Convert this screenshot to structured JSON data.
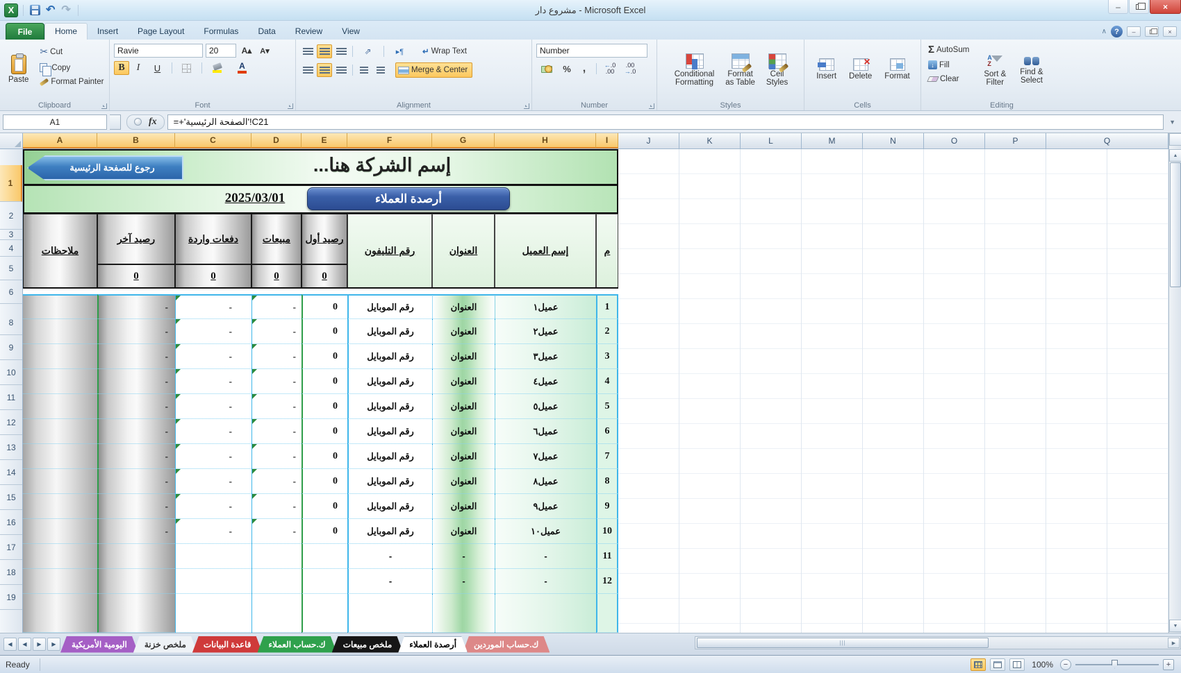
{
  "title_bar": {
    "title": "مشروع دار - Microsoft Excel"
  },
  "icons": {
    "dropdown": "▾",
    "undo": "↶",
    "redo": "↷",
    "minimize": "–",
    "close": "×",
    "help": "?",
    "collapse": "∧",
    "cut": "✂",
    "sum": "Σ",
    "percent": "%",
    "comma": ",",
    "wrap": "↵",
    "para": "▸¶",
    "orient": "⇗",
    "fill_down": "↓",
    "nav_first": "◀",
    "nav_prev": "◀",
    "nav_next": "▶",
    "nav_last": "▶",
    "scroll_up": "▲",
    "scroll_down": "▼",
    "scroll_right": "▶",
    "grip": "|||",
    "zoom_minus": "−",
    "zoom_plus": "+",
    "grow_font": "A▴",
    "shrink_font": "A▾"
  },
  "ribbon_tabs": [
    "File",
    "Home",
    "Insert",
    "Page Layout",
    "Formulas",
    "Data",
    "Review",
    "View"
  ],
  "ribbon": {
    "clipboard": {
      "label": "Clipboard",
      "paste": "Paste",
      "cut": "Cut",
      "copy": "Copy",
      "format_painter": "Format Painter"
    },
    "font": {
      "label": "Font",
      "name": "Ravie",
      "size": "20",
      "bold": "B",
      "italic": "I",
      "underline": "U"
    },
    "alignment": {
      "label": "Alignment",
      "wrap_text": "Wrap Text",
      "merge_center": "Merge & Center"
    },
    "number": {
      "label": "Number",
      "format": "Number",
      "percent": "%",
      "comma": ","
    },
    "styles": {
      "label": "Styles",
      "conditional_1": "Conditional",
      "conditional_2": "Formatting",
      "format_table_1": "Format",
      "format_table_2": "as Table",
      "cell_styles_1": "Cell",
      "cell_styles_2": "Styles"
    },
    "cells": {
      "label": "Cells",
      "insert": "Insert",
      "delete": "Delete",
      "format": "Format"
    },
    "editing": {
      "label": "Editing",
      "autosum": "AutoSum",
      "fill": "Fill",
      "clear": "Clear",
      "sort_1": "Sort &",
      "sort_2": "Filter",
      "find_1": "Find &",
      "find_2": "Select"
    }
  },
  "formula_bar": {
    "name_box": "A1",
    "fx": "fx",
    "formula": "=+'الصفحة الرئيسية'!C21"
  },
  "sheet": {
    "columns": [
      "A",
      "B",
      "C",
      "D",
      "E",
      "F",
      "G",
      "H",
      "I",
      "J",
      "K",
      "L",
      "M",
      "N",
      "O",
      "P",
      "Q"
    ],
    "row_numbers": [
      "1",
      "2",
      "3",
      "4",
      "5",
      "6",
      "8",
      "9",
      "10",
      "11",
      "12",
      "13",
      "14",
      "15",
      "16",
      "17",
      "18",
      "19"
    ],
    "back_button": "رجوع للصفحة الرئيسية",
    "company_title": "إسم الشركة هنا...",
    "date": "2025/03/01",
    "badge": "أرصدة العملاء",
    "headers": {
      "notes": "ملاحظات",
      "closing": "رصيد آخر",
      "payments": "دفعات واردة",
      "sales": "مبيعات",
      "opening": "رصيد أول",
      "phone": "رقم التليفون",
      "address": "العنوان",
      "name": "إسم العميل",
      "num": "م"
    },
    "totals": {
      "closing": "0",
      "payments": "0",
      "sales": "0",
      "opening": "0"
    },
    "rows": [
      {
        "num": "1",
        "name": "عميل١",
        "address": "العنوان",
        "phone": "رقم الموبايل",
        "opening": "0",
        "sales": "-",
        "payments": "-",
        "closing": "-",
        "error_marker": true
      },
      {
        "num": "2",
        "name": "عميل٢",
        "address": "العنوان",
        "phone": "رقم الموبايل",
        "opening": "0",
        "sales": "-",
        "payments": "-",
        "closing": "-",
        "error_marker": true
      },
      {
        "num": "3",
        "name": "عميل٣",
        "address": "العنوان",
        "phone": "رقم الموبايل",
        "opening": "0",
        "sales": "-",
        "payments": "-",
        "closing": "-",
        "error_marker": true
      },
      {
        "num": "4",
        "name": "عميل٤",
        "address": "العنوان",
        "phone": "رقم الموبايل",
        "opening": "0",
        "sales": "-",
        "payments": "-",
        "closing": "-",
        "error_marker": true
      },
      {
        "num": "5",
        "name": "عميل٥",
        "address": "العنوان",
        "phone": "رقم الموبايل",
        "opening": "0",
        "sales": "-",
        "payments": "-",
        "closing": "-",
        "error_marker": true
      },
      {
        "num": "6",
        "name": "عميل٦",
        "address": "العنوان",
        "phone": "رقم الموبايل",
        "opening": "0",
        "sales": "-",
        "payments": "-",
        "closing": "-",
        "error_marker": true
      },
      {
        "num": "7",
        "name": "عميل٧",
        "address": "العنوان",
        "phone": "رقم الموبايل",
        "opening": "0",
        "sales": "-",
        "payments": "-",
        "closing": "-",
        "error_marker": true
      },
      {
        "num": "8",
        "name": "عميل٨",
        "address": "العنوان",
        "phone": "رقم الموبايل",
        "opening": "0",
        "sales": "-",
        "payments": "-",
        "closing": "-",
        "error_marker": true
      },
      {
        "num": "9",
        "name": "عميل٩",
        "address": "العنوان",
        "phone": "رقم الموبايل",
        "opening": "0",
        "sales": "-",
        "payments": "-",
        "closing": "-",
        "error_marker": true
      },
      {
        "num": "10",
        "name": "عميل١٠",
        "address": "العنوان",
        "phone": "رقم الموبايل",
        "opening": "0",
        "sales": "-",
        "payments": "-",
        "closing": "-",
        "error_marker": true
      },
      {
        "num": "11",
        "name": "-",
        "address": "-",
        "phone": "-",
        "opening": "",
        "sales": "",
        "payments": "",
        "closing": "",
        "error_marker": false
      },
      {
        "num": "12",
        "name": "-",
        "address": "-",
        "phone": "-",
        "opening": "",
        "sales": "",
        "payments": "",
        "closing": "",
        "error_marker": false
      }
    ]
  },
  "sheet_tabs": [
    {
      "label": "اليومية الأمريكية",
      "color": "#a55fc5",
      "text_color": "#ffffff",
      "active": false
    },
    {
      "label": "ملخص خزنة",
      "color": "#eef2f6",
      "text_color": "#333333",
      "active": false
    },
    {
      "label": "قاعدة البيانات",
      "color": "#cf3a3a",
      "text_color": "#ffffff",
      "active": false
    },
    {
      "label": "ك.حساب العملاء",
      "color": "#2fa14c",
      "text_color": "#ffffff",
      "active": false
    },
    {
      "label": "ملخص مبيعات",
      "color": "#161616",
      "text_color": "#ffffff",
      "active": false
    },
    {
      "label": "أرصدة العملاء",
      "color": "#ffffff",
      "text_color": "#000000",
      "active": true
    },
    {
      "label": "ك.حساب الموردين",
      "color": "#dd8888",
      "text_color": "#ffffff",
      "active": false
    }
  ],
  "status_bar": {
    "ready": "Ready",
    "zoom_level": "100%"
  },
  "colors": {
    "selection_amber": "#f9c86a",
    "table_border_cyan": "#3fb6ea",
    "badge_blue": "#3a5fa8",
    "back_button_blue": "#3e7fc1",
    "band_green": "#b2e2b2",
    "file_button_green": "#1f7a3c"
  }
}
